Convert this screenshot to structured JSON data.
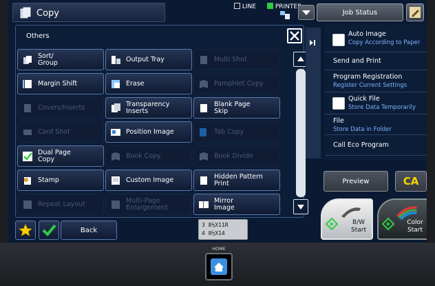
{
  "header": {
    "title": "Copy",
    "line_label": "LINE",
    "printer_label": "PRINTER",
    "job_status_label": "Job Status"
  },
  "others": {
    "title": "Others",
    "functions": [
      {
        "label": "Sort/\nGroup",
        "enabled": true,
        "icon": "sort-group-icon"
      },
      {
        "label": "Output Tray",
        "enabled": true,
        "icon": "output-tray-icon"
      },
      {
        "label": "Multi Shot",
        "enabled": false,
        "icon": "multi-shot-icon"
      },
      {
        "label": "Margin Shift",
        "enabled": true,
        "icon": "margin-shift-icon"
      },
      {
        "label": "Erase",
        "enabled": true,
        "icon": "erase-icon"
      },
      {
        "label": "Pamphlet Copy",
        "enabled": false,
        "icon": "pamphlet-copy-icon"
      },
      {
        "label": "Covers/Inserts",
        "enabled": false,
        "icon": "covers-inserts-icon"
      },
      {
        "label": "Transparency\nInserts",
        "enabled": true,
        "icon": "transparency-inserts-icon"
      },
      {
        "label": "Blank Page\nSkip",
        "enabled": true,
        "icon": "blank-page-skip-icon"
      },
      {
        "label": "Card Shot",
        "enabled": false,
        "icon": "card-shot-icon"
      },
      {
        "label": "Position Image",
        "enabled": true,
        "icon": "position-image-icon"
      },
      {
        "label": "Tab Copy",
        "enabled": false,
        "icon": "tab-copy-icon"
      },
      {
        "label": "Dual Page\nCopy",
        "enabled": true,
        "icon": "dual-page-copy-icon"
      },
      {
        "label": "Book Copy",
        "enabled": false,
        "icon": "book-copy-icon"
      },
      {
        "label": "Book Divide",
        "enabled": false,
        "icon": "book-divide-icon"
      },
      {
        "label": "Stamp",
        "enabled": true,
        "icon": "stamp-icon"
      },
      {
        "label": "Custom Image",
        "enabled": true,
        "icon": "custom-image-icon"
      },
      {
        "label": "Hidden Pattern\nPrint",
        "enabled": true,
        "icon": "hidden-pattern-print-icon"
      },
      {
        "label": "Repeat Layout",
        "enabled": false,
        "icon": "repeat-layout-icon"
      },
      {
        "label": "Multi-Page\nEnlargement",
        "enabled": false,
        "icon": "multi-page-enlargement-icon"
      },
      {
        "label": "Mirror\nImage",
        "enabled": true,
        "icon": "mirror-image-icon"
      }
    ]
  },
  "side_menu": {
    "items": [
      {
        "title": "Auto Image",
        "sub": "Copy According to Paper",
        "checkbox": true
      },
      {
        "title": "Send and Print",
        "sub": "",
        "checkbox": false
      },
      {
        "title": "Program Registration",
        "sub": "Register Current Settings",
        "checkbox": false
      },
      {
        "title": "Quick File",
        "sub": "Store Data Temporarily",
        "checkbox": true
      },
      {
        "title": "File",
        "sub": "Store Data in Folder",
        "checkbox": false
      },
      {
        "title": "Call Eco Program",
        "sub": "",
        "checkbox": false
      }
    ]
  },
  "bottom": {
    "back_label": "Back",
    "paper_line1": "3 8½X11R",
    "paper_line2": "4 8½X14",
    "preview_label": "Preview",
    "ca_label": "CA",
    "bw_start_line1": "B/W",
    "bw_start_line2": "Start",
    "color_start_line1": "Color",
    "color_start_line2": "Start",
    "home_label": "HOME"
  },
  "colors": {
    "screen_bg": "#0a1a33",
    "panel_border": "#5a7ab0",
    "subtitle_blue": "#7fb3ff",
    "ca_yellow": "#ffd200",
    "start_green": "#2ecc40"
  }
}
